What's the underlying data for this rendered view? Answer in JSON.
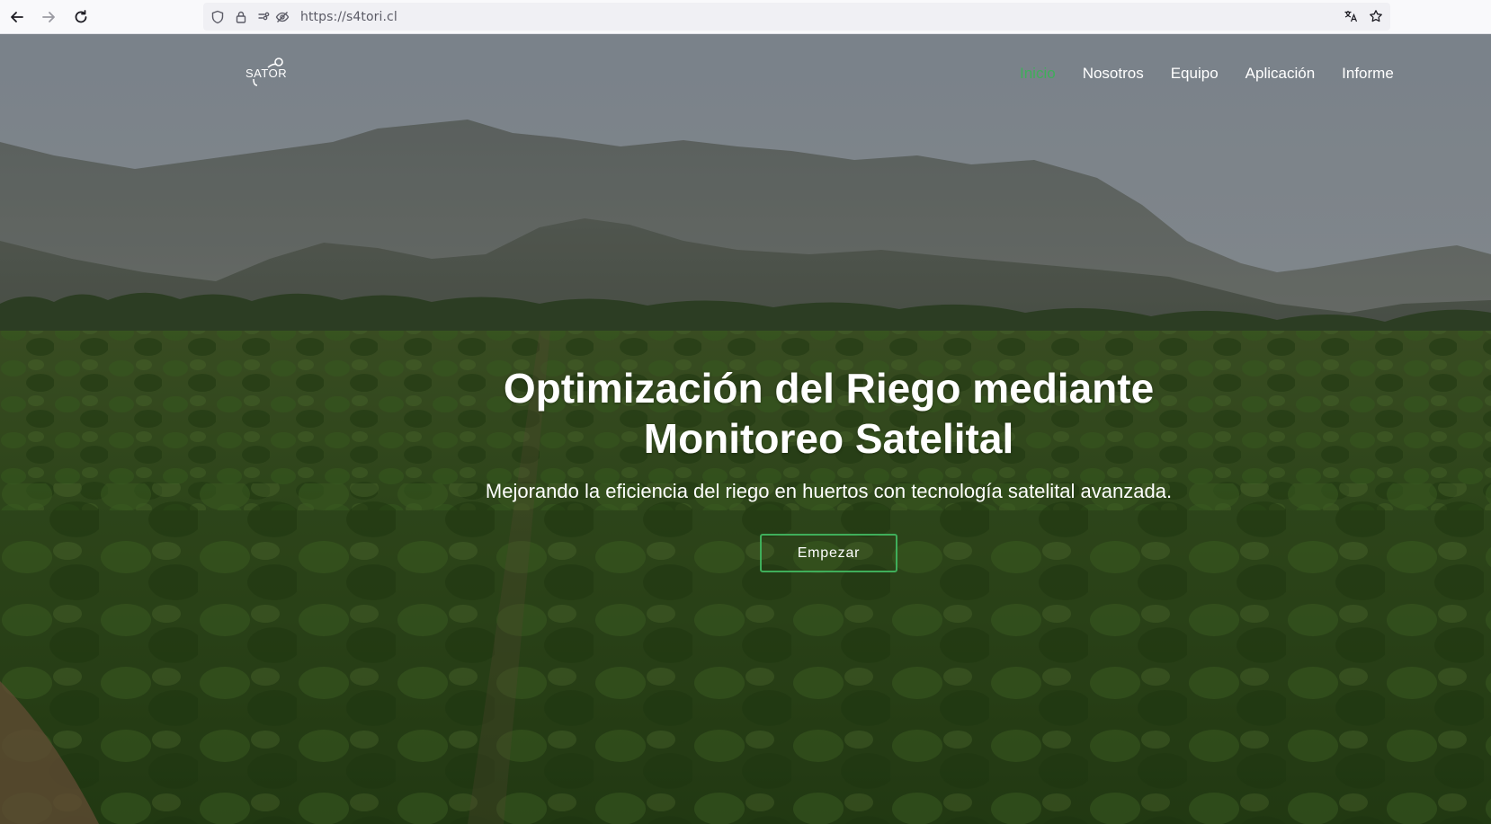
{
  "browser": {
    "url": "https://s4tori.cl",
    "back_icon": "arrow-left-icon",
    "forward_icon": "arrow-right-icon",
    "reload_icon": "reload-icon"
  },
  "site": {
    "logo_text": "SATORI",
    "nav": [
      {
        "label": "Inicio",
        "active": true
      },
      {
        "label": "Nosotros",
        "active": false
      },
      {
        "label": "Equipo",
        "active": false
      },
      {
        "label": "Aplicación",
        "active": false
      },
      {
        "label": "Informe",
        "active": false
      }
    ],
    "accent_color": "#3fae5a"
  },
  "hero": {
    "title_line1": "Optimización del Riego mediante",
    "title_line2": "Monitoreo Satelital",
    "subtitle": "Mejorando la eficiencia del riego en huertos con tecnología satelital avanzada.",
    "cta_label": "Empezar"
  }
}
